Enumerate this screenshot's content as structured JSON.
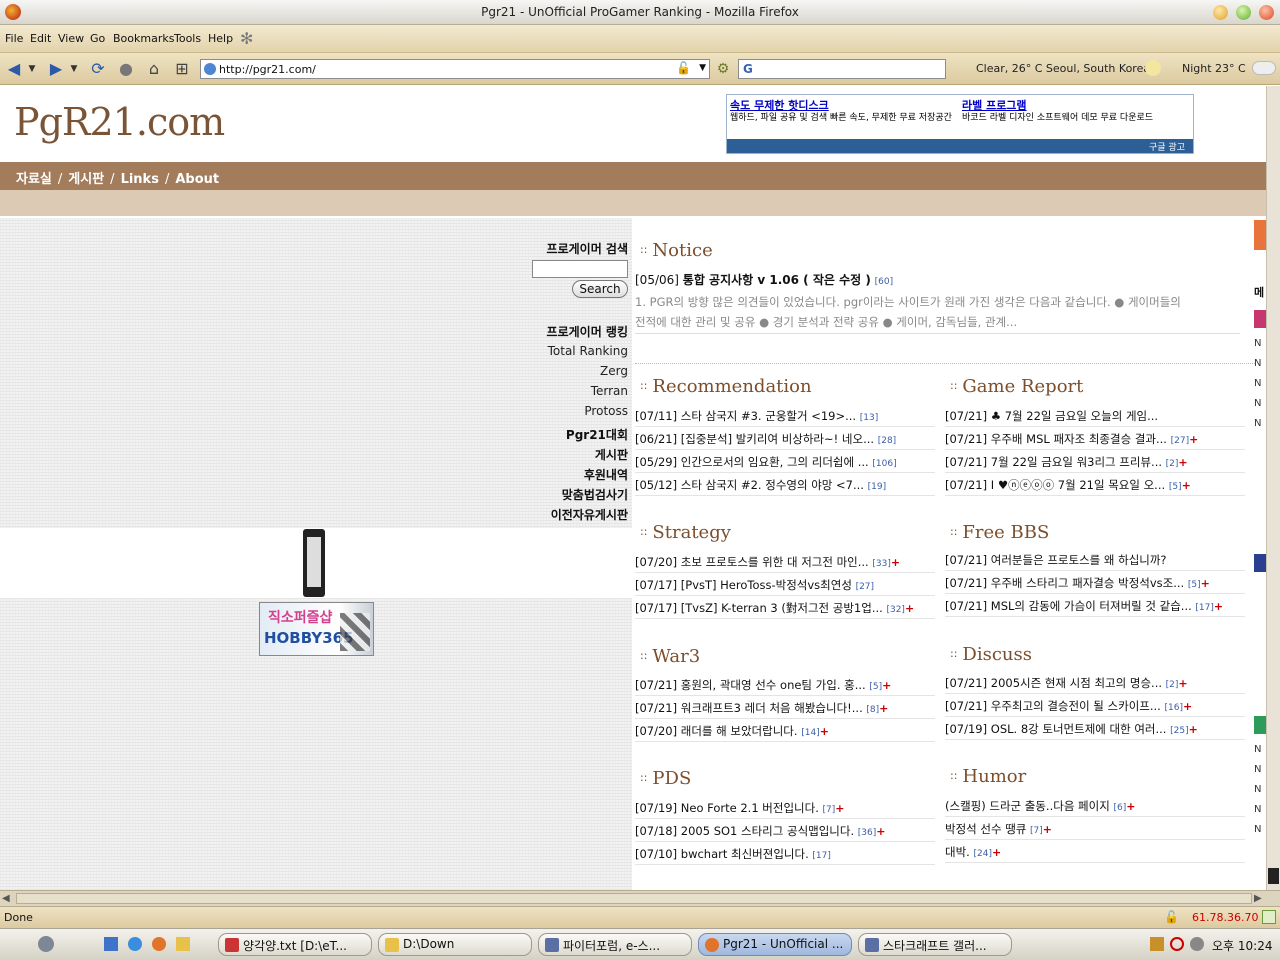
{
  "window": {
    "title": "Pgr21 - UnOfficial ProGamer Ranking - Mozilla Firefox"
  },
  "menu": [
    "File",
    "Edit",
    "View",
    "Go",
    "Bookmarks",
    "Tools",
    "Help"
  ],
  "toolbar": {
    "url": "http://pgr21.com/",
    "search_engine": "G",
    "weather_now": "Clear, 26° C  Seoul, South Korea",
    "weather_night": "Night  23° C"
  },
  "site": {
    "logo": "PgR21.com",
    "nav": [
      "자료실",
      "게시판",
      "Links",
      "About"
    ],
    "ad": {
      "left_title": "속도 무제한 핫디스크",
      "left_body": "웹하드, 파일 공유 및 검색 빠른 속도, 무제한 무료 저장공간",
      "right_title": "라벨 프로그램",
      "right_body": "바코드 라벨 디자인 소프트웨어 데모 무료 다운로드",
      "footer": "구글 광고"
    },
    "sidebar": {
      "search_title": "프로게이머 검색",
      "search_button": "Search",
      "ranking_title": "프로게이머 랭킹",
      "ranking_items": [
        "Total Ranking",
        "Zerg",
        "Terran",
        "Protoss"
      ],
      "links": [
        "Pgr21대회",
        "게시판",
        "후원내역",
        "맞춤법검사기",
        "이전자유게시판"
      ],
      "hobby_top": "직소퍼즐샵",
      "hobby_bottom": "HOBBY365"
    },
    "notice": {
      "title": "Notice",
      "headline_date": "[05/06]",
      "headline": "통합 공지사항 v 1.06 ( 작은 수정 )",
      "headline_count": "[60]",
      "body_line1": "1. PGR의 방향 많은 의견들이 있었습니다. pgr이라는 사이트가 원래 가진 생각은 다음과 같습니다. ● 게이머들의",
      "body_line2": "전적에 대한 관리 및 공유 ● 경기 분석과 전략 공유 ● 게이머, 감독님들, 관계..."
    },
    "sections": {
      "recommendation": {
        "title": "Recommendation",
        "items": [
          {
            "text": "[07/11] 스타 삼국지 #3. 군웅할거 <19>...",
            "count": "[13]",
            "plus": ""
          },
          {
            "text": "[06/21] [집중분석] 발키리여 비상하라~! 네오...",
            "count": "[28]",
            "plus": ""
          },
          {
            "text": "[05/29] 인간으로서의 임요환, 그의 리더쉽에 ...",
            "count": "[106]",
            "plus": ""
          },
          {
            "text": "[05/12] 스타 삼국지 #2. 정수영의 야망 <7...",
            "count": "[19]",
            "plus": ""
          }
        ]
      },
      "game_report": {
        "title": "Game Report",
        "items": [
          {
            "text": "[07/21] ♣ 7월 22일 금요일 오늘의 게임...",
            "count": "",
            "plus": ""
          },
          {
            "text": "[07/21] 우주배 MSL 패자조 최종결승 결과...",
            "count": "[27]",
            "plus": "+"
          },
          {
            "text": "[07/21] 7월 22일 금요일 워3리그 프리뷰...",
            "count": "[2]",
            "plus": "+"
          },
          {
            "text": "[07/21]  I ♥ⓝⓔⓞⓞ 7월 21일 목요일 오...",
            "count": "[5]",
            "plus": "+"
          }
        ]
      },
      "strategy": {
        "title": "Strategy",
        "items": [
          {
            "text": "[07/20] 초보 프로토스를 위한 대 저그전 마인...",
            "count": "[33]",
            "plus": "+"
          },
          {
            "text": "[07/17] [PvsT] HeroToss-박정석vs최연성",
            "count": "[27]",
            "plus": ""
          },
          {
            "text": "[07/17] [TvsZ] K-terran 3 (對저그전 공방1업...",
            "count": "[32]",
            "plus": "+"
          }
        ]
      },
      "free_bbs": {
        "title": "Free BBS",
        "items": [
          {
            "text": "[07/21] 여러분들은 프로토스를 왜 하십니까?",
            "count": "",
            "plus": ""
          },
          {
            "text": "[07/21] 우주배 스타리그 패자결승 박정석vs조...",
            "count": "[5]",
            "plus": "+"
          },
          {
            "text": "[07/21] MSL의 감동에 가슴이 터져버릴 것 같습...",
            "count": "[17]",
            "plus": "+"
          }
        ]
      },
      "war3": {
        "title": "War3",
        "items": [
          {
            "text": "[07/21] 홍원의, 곽대영 선수 one팀 가입. 홍...",
            "count": "[5]",
            "plus": "+"
          },
          {
            "text": "[07/21] 워크래프트3 레더 처음 해봤습니다!...",
            "count": "[8]",
            "plus": "+"
          },
          {
            "text": "[07/20] 래더를 해 보았더랍니다.",
            "count": "[14]",
            "plus": "+"
          }
        ]
      },
      "discuss": {
        "title": "Discuss",
        "items": [
          {
            "text": "[07/21] 2005시즌 현재 시점 최고의 명승...",
            "count": "[2]",
            "plus": "+"
          },
          {
            "text": "[07/21] 우주최고의 결승전이 될 스카이프...",
            "count": "[16]",
            "plus": "+"
          },
          {
            "text": "[07/19] OSL. 8강 토너먼트제에 대한 여러...",
            "count": "[25]",
            "plus": "+"
          }
        ]
      },
      "pds": {
        "title": "PDS",
        "items": [
          {
            "text": "[07/19] Neo Forte 2.1 버전입니다.",
            "count": "[7]",
            "plus": "+"
          },
          {
            "text": "[07/18] 2005 SO1 스타리그 공식맵입니다.",
            "count": "[36]",
            "plus": "+"
          },
          {
            "text": "[07/10] bwchart 최신버젼입니다.",
            "count": "[17]",
            "plus": ""
          }
        ]
      },
      "humor": {
        "title": "Humor",
        "items": [
          {
            "text": "(스캘핑) 드라군 출동..다음 페이지",
            "count": "[6]",
            "plus": "+"
          },
          {
            "text": "박정석 선수 땡큐",
            "count": "[7]",
            "plus": "+"
          },
          {
            "text": "대박.",
            "count": "[24]",
            "plus": "+"
          }
        ]
      }
    },
    "right_edge_labels": [
      "메",
      "N",
      "N",
      "N",
      "N",
      "N",
      "N",
      "N",
      "N",
      "N",
      "N"
    ]
  },
  "status": {
    "text": "Done",
    "ip": "61.78.36.70"
  },
  "taskbar": {
    "tasks": [
      "양각양.txt [D:\\eT...",
      "D:\\Down",
      "파이터포럼, e-스...",
      "Pgr21 - UnOfficial ...",
      "스타크래프트 갤러..."
    ],
    "clock": "오후 10:24"
  },
  "colors": {
    "brown_bar": "#a37c5c",
    "section_title": "#7c4e2b",
    "count": "#3a5ea8",
    "plus": "#cc0000"
  }
}
